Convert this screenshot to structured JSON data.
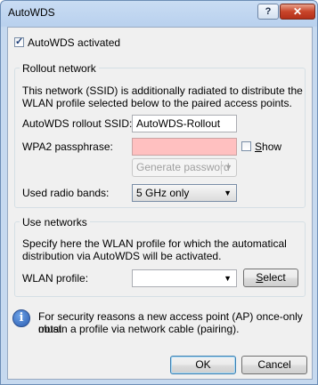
{
  "window": {
    "title": "AutoWDS",
    "help_label": "?",
    "close_label": "✕"
  },
  "autowds_activated": {
    "label": "AutoWDS activated",
    "checked": true
  },
  "rollout_network": {
    "title": "Rollout network",
    "description_line1": "This network (SSID) is additionally radiated to distribute the",
    "description_line2": "WLAN profile selected below to the paired access points.",
    "ssid_label": "AutoWDS rollout SSID:",
    "ssid_value": "AutoWDS-Rollout",
    "passphrase_label": "WPA2 passphrase:",
    "passphrase_value": "",
    "show_label": "Show",
    "show_checked": false,
    "generate_password_label": "Generate password",
    "radio_bands_label": "Used radio bands:",
    "radio_bands_value": "5 GHz only"
  },
  "use_networks": {
    "title": "Use networks",
    "description_line1": "Specify here the WLAN profile for which the automatical",
    "description_line2": "distribution via AutoWDS will be activated.",
    "profile_label": "WLAN profile:",
    "profile_value": "",
    "select_label": "Select"
  },
  "info": {
    "icon": "info-icon",
    "line1": "For security reasons a new access point (AP) once-only must",
    "line2": "obtain a profile via network cable (pairing)."
  },
  "buttons": {
    "ok": "OK",
    "cancel": "Cancel"
  }
}
